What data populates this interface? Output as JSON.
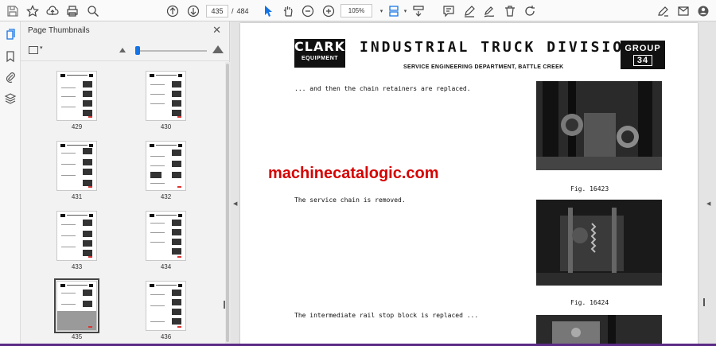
{
  "toolbar": {
    "current_page": "435",
    "page_separator": "/",
    "total_pages": "484",
    "zoom": "105%"
  },
  "panel": {
    "title": "Page Thumbnails",
    "close_glyph": "✕"
  },
  "thumbnails": [
    {
      "label": "429"
    },
    {
      "label": "430"
    },
    {
      "label": "431"
    },
    {
      "label": "432"
    },
    {
      "label": "433"
    },
    {
      "label": "434"
    },
    {
      "label": "435"
    },
    {
      "label": "436"
    }
  ],
  "document": {
    "logo_line1": "CLARK",
    "logo_line2": "EQUIPMENT",
    "title": "INDUSTRIAL TRUCK DIVISION",
    "subtitle": "SERVICE ENGINEERING DEPARTMENT, BATTLE CREEK",
    "group_label": "GROUP",
    "group_number": "34",
    "caption1": "... and then the chain retainers are replaced.",
    "caption2": "The service chain is removed.",
    "caption3": "The intermediate rail stop block is replaced ...",
    "fig1": "Fig. 16423",
    "fig2": "Fig. 16424",
    "watermark": "machinecatalogic.com"
  },
  "colors": {
    "accent": "#1473e6",
    "watermark": "#d60000"
  }
}
